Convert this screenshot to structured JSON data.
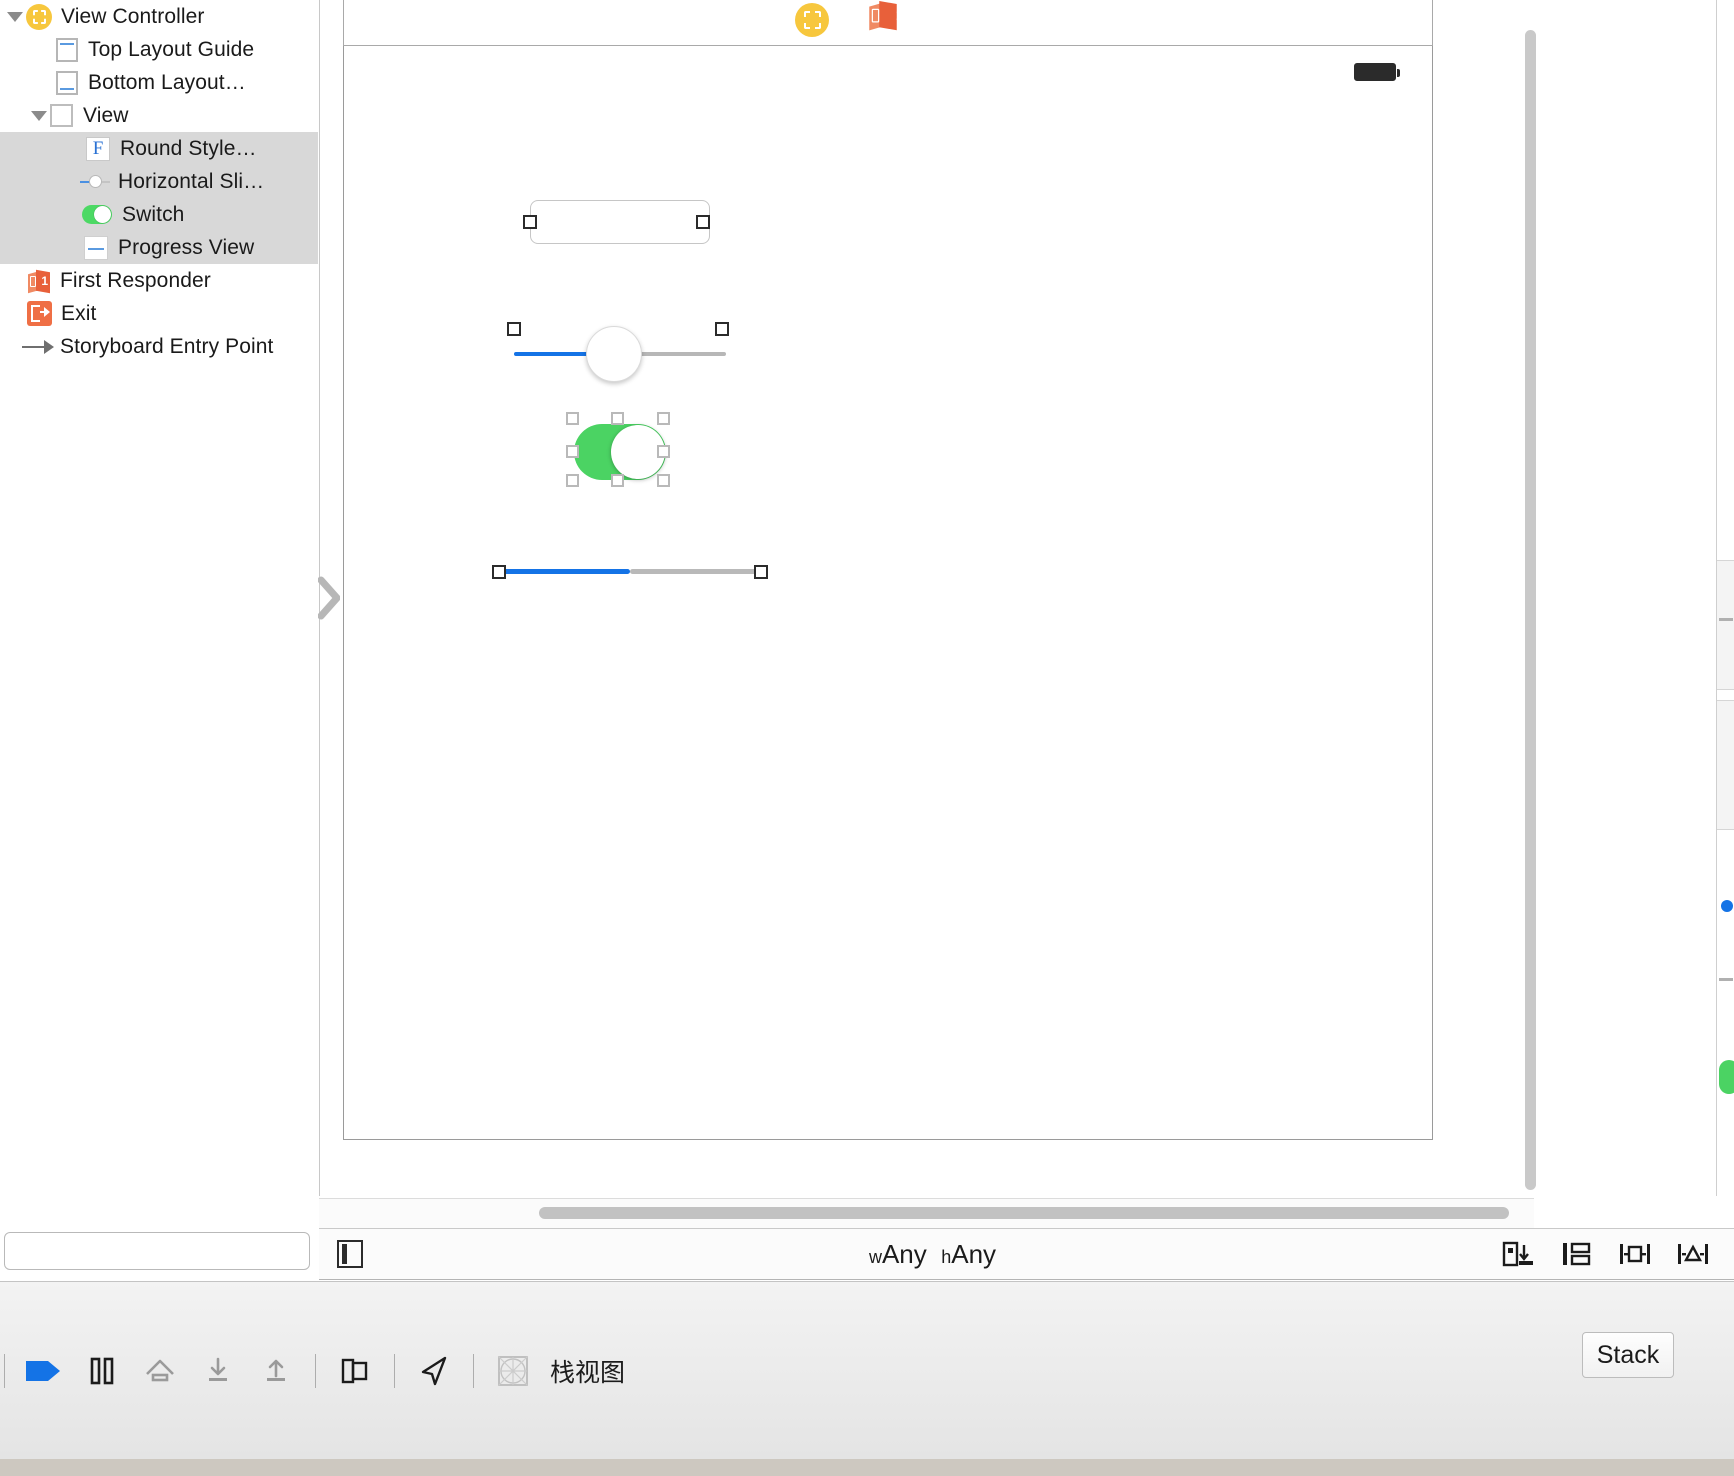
{
  "app": {
    "name": "Xcode Interface Builder"
  },
  "outline": {
    "items": [
      {
        "label": "View Controller",
        "icon": "view-controller-icon",
        "depth": 0,
        "selected": false,
        "disclosure": "open"
      },
      {
        "label": "Top Layout Guide",
        "icon": "top-layout-guide-icon",
        "depth": 1,
        "selected": false,
        "disclosure": "none"
      },
      {
        "label": "Bottom Layout…",
        "icon": "bottom-layout-guide-icon",
        "depth": 1,
        "selected": false,
        "disclosure": "none"
      },
      {
        "label": "View",
        "icon": "view-icon",
        "depth": 1,
        "selected": false,
        "disclosure": "open"
      },
      {
        "label": "Round Style…",
        "icon": "text-field-icon",
        "depth": 2,
        "selected": true,
        "disclosure": "none"
      },
      {
        "label": "Horizontal Sli…",
        "icon": "slider-icon",
        "depth": 2,
        "selected": true,
        "disclosure": "none"
      },
      {
        "label": "Switch",
        "icon": "switch-icon",
        "depth": 2,
        "selected": true,
        "disclosure": "none"
      },
      {
        "label": "Progress View",
        "icon": "progress-view-icon",
        "depth": 2,
        "selected": true,
        "disclosure": "none"
      },
      {
        "label": "First Responder",
        "icon": "first-responder-icon",
        "depth": 0,
        "selected": false,
        "disclosure": "none"
      },
      {
        "label": "Exit",
        "icon": "exit-icon",
        "depth": 0,
        "selected": false,
        "disclosure": "none"
      },
      {
        "label": "Storyboard Entry Point",
        "icon": "storyboard-entry-point-icon",
        "depth": 0,
        "selected": false,
        "disclosure": "none"
      }
    ],
    "filter_placeholder": ""
  },
  "scene_dock": {
    "items": [
      {
        "name": "view-controller-dock-icon",
        "title": "View Controller"
      },
      {
        "name": "first-responder-dock-icon",
        "title": "First Responder"
      },
      {
        "name": "exit-dock-icon",
        "title": "Exit"
      }
    ]
  },
  "canvas": {
    "status_bar": {
      "battery": "battery-icon"
    },
    "widgets": [
      {
        "name": "round-style-text-field",
        "type": "textfield",
        "value": "",
        "selected": false
      },
      {
        "name": "horizontal-slider",
        "type": "slider",
        "value": 45,
        "min": 0,
        "max": 100,
        "selected": false
      },
      {
        "name": "switch-control",
        "type": "switch",
        "value": "on",
        "selected": true
      },
      {
        "name": "progress-view",
        "type": "progress",
        "value": 50,
        "selected": false
      }
    ]
  },
  "size_class_bar": {
    "width_prefix": "w",
    "width_value": "Any",
    "height_prefix": "h",
    "height_value": "Any",
    "left_icon": "size-class-toggle-icon",
    "right_icons": [
      {
        "name": "align-icon",
        "label": "Align"
      },
      {
        "name": "pin-icon",
        "label": "Pin"
      },
      {
        "name": "resolve-auto-layout-icon",
        "label": "Resolve Auto Layout Issues"
      },
      {
        "name": "update-frames-icon",
        "label": "Update Frames"
      }
    ]
  },
  "bottom_toolbar": {
    "items": [
      {
        "name": "divider-left",
        "type": "divider"
      },
      {
        "name": "run-arrow-icon",
        "type": "icon"
      },
      {
        "name": "pause-icon",
        "type": "icon"
      },
      {
        "name": "home-icon",
        "type": "icon"
      },
      {
        "name": "download-icon",
        "type": "icon"
      },
      {
        "name": "upload-icon",
        "type": "icon"
      },
      {
        "name": "separator-1",
        "type": "separator"
      },
      {
        "name": "split-view-icon",
        "type": "icon"
      },
      {
        "name": "separator-2",
        "type": "separator"
      },
      {
        "name": "location-arrow-icon",
        "type": "icon"
      },
      {
        "name": "separator-3",
        "type": "separator"
      },
      {
        "name": "stack-view-grid-icon",
        "type": "icon"
      }
    ],
    "label": "栈视图",
    "stack_button": "Stack"
  },
  "colors": {
    "selection_row": "#d8d8d8",
    "switch_green": "#4bd363",
    "slider_blue": "#1473e6",
    "accent_orange": "#ef6f45",
    "vc_yellow": "#f7c73d"
  }
}
